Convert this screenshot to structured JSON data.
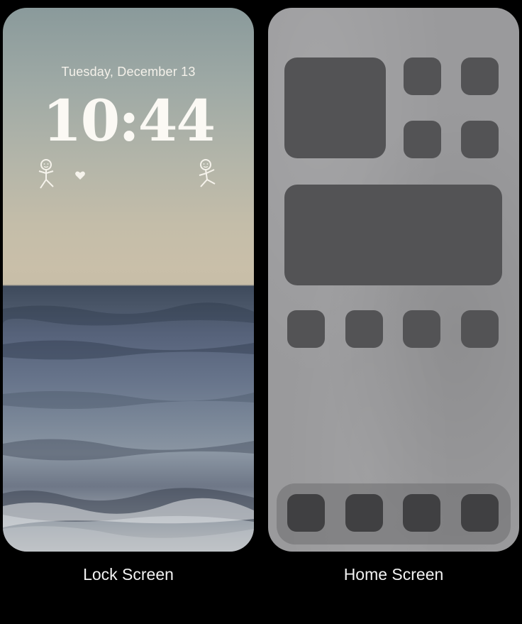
{
  "lock_screen": {
    "date": "Tuesday, December 13",
    "time": "10:44",
    "caption": "Lock Screen",
    "widgets": [
      "stick-figure-icon",
      "heart-icon",
      "stick-figure-icon"
    ]
  },
  "home_screen": {
    "caption": "Home Screen",
    "widget_placeholders": [
      "large-widget",
      "wide-widget"
    ],
    "app_placeholders_count_top_grid": 4,
    "app_placeholders_count_row": 4,
    "dock_placeholders_count": 4
  },
  "colors": {
    "background": "#000000",
    "tile": "#535355",
    "dock_tile": "#404042",
    "label": "#f2f2f2"
  }
}
